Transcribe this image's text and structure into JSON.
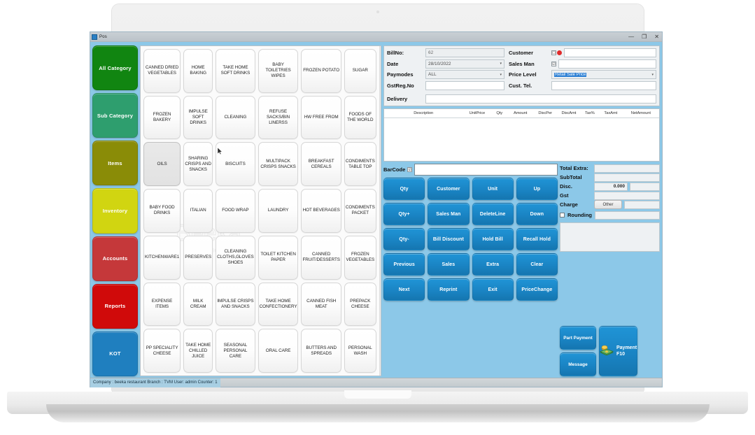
{
  "window": {
    "title": "Pos",
    "app_icon": "window-app-icon",
    "controls": {
      "minimize": "—",
      "maximize": "❐",
      "close": "✕"
    }
  },
  "sidebar": {
    "items": [
      {
        "label": "All Category",
        "color": "#118511"
      },
      {
        "label": "Sub Category",
        "color": "#2e9e6e"
      },
      {
        "label": "Items",
        "color": "#8a8c07"
      },
      {
        "label": "Inventory",
        "color": "#d1d511"
      },
      {
        "label": "Accounts",
        "color": "#c5383a"
      },
      {
        "label": "Reports",
        "color": "#d00a0a"
      },
      {
        "label": "KOT",
        "color": "#1f7fbf"
      }
    ]
  },
  "product_grid": {
    "watermark": "Beeka Technologies",
    "hovered_tile": "OILS",
    "tiles": [
      "CANNED DRIED VEGETABLES",
      "HOME BAKING",
      "TAKE HOME SOFT DRINKS",
      "BABY TOILETRIES WIPES",
      "FROZEN POTATO",
      "SUGAR",
      "FROZEN BAKERY",
      "IMPULSE SOFT DRINKS",
      "CLEANING",
      "REFUSE SACKS/BIN LINERSS",
      "HW FREE FROM",
      "FOODS OF THE WORLD",
      "OILS",
      "SHARING CRISPS AND SNACKS",
      "BISCUITS",
      "MULTIPACK CRISPS SNACKS",
      "BREAKFAST CEREALS",
      "CONDIMENTS TABLE TOP",
      "BABY FOOD DRINKS",
      "ITALIAN",
      "FOOD WRAP",
      "LAUNDRY",
      "HOT BEVERAGES",
      "CONDIMENTS PACKET",
      "KITCHENWARE1",
      "PRESERVES",
      "CLEANING CLOTHS,GLOVES SHOES",
      "TOILET KITCHEN PAPER",
      "CANNED FRUIT/DESSERTS",
      "FROZEN VEGETABLES",
      "EXPENSE ITEMS",
      "MILK CREAM",
      "IMPULSE CRISPS AND SNACKS",
      "TAKE HOME CONFECTIONERY",
      "CANNED FISH  MEAT",
      "PREPACK CHEESE",
      "PP SPECIALITY CHEESE",
      "TAKE HOME CHILLED JUICE",
      "SEASONAL PERSONAL CARE",
      "ORAL CARE",
      "BUTTERS AND SPREADS",
      "PERSONAL WASH"
    ],
    "scrollbar": {
      "up_arrow": "▲",
      "down_arrow": "▼"
    }
  },
  "bill_header": {
    "left_fields": [
      {
        "label": "BillNo:",
        "value": "62",
        "type": "text"
      },
      {
        "label": "Date",
        "value": "28/10/2022",
        "type": "combo"
      },
      {
        "label": "Paymodes",
        "value": "ALL",
        "type": "combo"
      },
      {
        "label": "GstReg.No",
        "value": "",
        "type": "text"
      }
    ],
    "right_fields": [
      {
        "label": "Customer",
        "value": "",
        "type": "text",
        "check": "☐",
        "badge": true
      },
      {
        "label": "Sales Man",
        "value": "",
        "type": "text",
        "check": "☑",
        "badge": false
      },
      {
        "label": "Price Level",
        "value": "Retail Sale Price",
        "type": "combo",
        "highlighted": true
      },
      {
        "label": "Cust. Tel.",
        "value": "",
        "type": "text"
      }
    ],
    "delivery": {
      "label": "Delivery",
      "value": ""
    }
  },
  "items_table": {
    "columns": [
      "Description",
      "UnitPrice",
      "Qty",
      "Amount",
      "DiscPer",
      "DiscAmt",
      "Tax%",
      "TaxAmt",
      "NetAmount"
    ],
    "rows": []
  },
  "barcode": {
    "label": "BarCode",
    "check": "☑",
    "value": ""
  },
  "action_buttons": [
    "Qty",
    "Customer",
    "Unit",
    "Up",
    "Qty+",
    "Sales Man",
    "DeleteLine",
    "Down",
    "Qty-",
    "Bill Discount",
    "Hold Bill",
    "Recall Hold",
    "Previous",
    "Sales",
    "Extra",
    "Clear",
    "Next",
    "Reprint",
    "Exit",
    "PriceChange"
  ],
  "side_buttons": [
    "Part Payment",
    "Message"
  ],
  "payment_button": {
    "label_line1": "Payment",
    "label_line2": "F10",
    "icon": "money-icon"
  },
  "totals": {
    "rows": [
      {
        "label": "Total Extra:",
        "pre": null,
        "value": ""
      },
      {
        "label": "SubTotal",
        "pre": null,
        "value": ""
      },
      {
        "label": "Disc.",
        "pre": "0.000",
        "value": ""
      },
      {
        "label": "Gst",
        "pre": null,
        "value": ""
      },
      {
        "label": "Charge",
        "pre": "Other",
        "value": "",
        "pre_is_button": true
      }
    ],
    "rounding": {
      "label": "Rounding",
      "checked": false,
      "value": ""
    }
  },
  "statusbar": {
    "text": "Company : beeka restaurant  Branch : TVM  User: admin  Counter: 1"
  }
}
